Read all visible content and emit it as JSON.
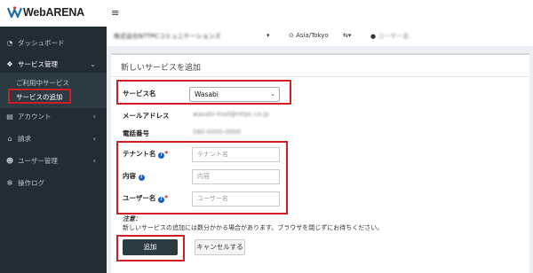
{
  "brand": {
    "logo_text": "WebARENA"
  },
  "header": {
    "menu_icon": "hamburger-icon"
  },
  "topbar": {
    "company": "株式会社NTTPCコミュニケーションズ",
    "timezone": "Asia/Tokyo",
    "language_icon": "translate-icon",
    "user": "ユーザー名"
  },
  "sidebar": {
    "items": [
      {
        "label": "ダッシュボード",
        "icon": "gauge-icon"
      },
      {
        "label": "サービス管理",
        "icon": "cubes-icon"
      },
      {
        "label": "アカウント",
        "icon": "id-card-icon"
      },
      {
        "label": "請求",
        "icon": "bank-icon"
      },
      {
        "label": "ユーザー管理",
        "icon": "users-icon"
      },
      {
        "label": "操作ログ",
        "icon": "cog-icon"
      }
    ],
    "sub_items": [
      {
        "label": "ご利用中サービス"
      },
      {
        "label": "サービスの追加"
      }
    ]
  },
  "form": {
    "title": "新しいサービスを追加",
    "service_label": "サービス名",
    "service_value": "Wasabi",
    "email_label": "メールアドレス",
    "email_value": "wasabi-mail@nttpc.co.jp",
    "phone_label": "電話番号",
    "phone_value": "080-0000-0000",
    "tenant_label": "テナント名",
    "tenant_placeholder": "テナント名",
    "content_label": "内容",
    "content_placeholder": "内容",
    "user_label": "ユーザー名",
    "user_placeholder": "ユーザー名",
    "note_title": "注意：",
    "note_text": "新しいサービスの追加には数分かかる場合があります。ブラウザを閉じずにお待ちください。",
    "add_button": "追加",
    "cancel_button": "キャンセルする"
  },
  "colors": {
    "highlight": "#d21d25",
    "sidebar": "#222d32",
    "primary_button": "#2c3b41"
  }
}
